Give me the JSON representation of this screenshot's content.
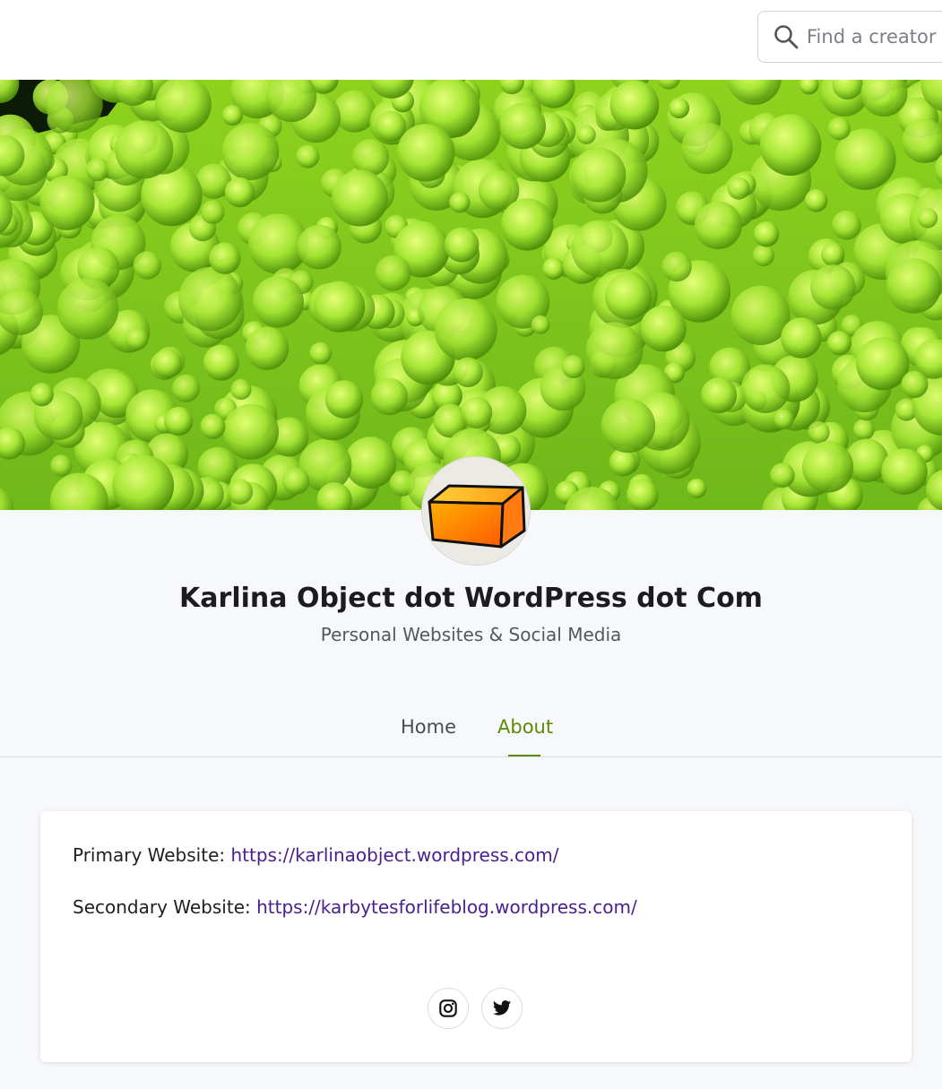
{
  "header": {
    "search_placeholder": "Find a creator"
  },
  "profile": {
    "name": "Karlina Object dot WordPress dot Com",
    "tagline": "Personal Websites & Social Media"
  },
  "tabs": [
    {
      "label": "Home",
      "active": false
    },
    {
      "label": "About",
      "active": true
    }
  ],
  "about": {
    "primary_label": "Primary Website:",
    "primary_url": "https://karlinaobject.wordpress.com/",
    "secondary_label": "Secondary Website:",
    "secondary_url": "https://karbytesforlifeblog.wordpress.com/"
  },
  "social": [
    {
      "icon": "instagram-icon"
    },
    {
      "icon": "twitter-icon"
    }
  ],
  "colors": {
    "accent": "#5c8a00",
    "link": "#4a1e8c",
    "cover": "#7bcc1c"
  }
}
